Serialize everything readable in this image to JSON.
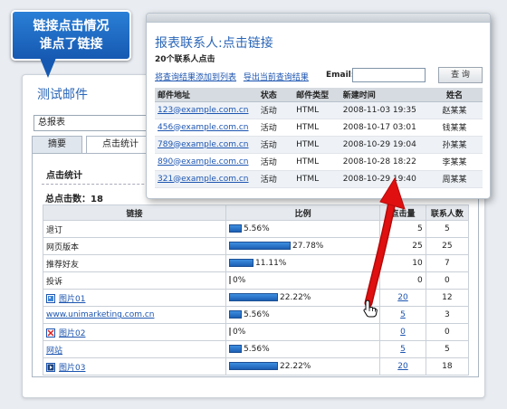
{
  "callout": {
    "line1": "链接点击情况",
    "line2": "谁点了链接"
  },
  "main": {
    "title": "测试邮件",
    "report_select": "总报表",
    "tabs": [
      {
        "label": "摘要"
      },
      {
        "label": "点击统计"
      }
    ],
    "stats_heading": "点击统计",
    "total_clicks": "总点击数：18"
  },
  "stats_table": {
    "headers": {
      "link": "链接",
      "ratio": "比例",
      "clicks": "点击量",
      "contacts": "联系人数"
    },
    "rows": [
      {
        "link": "退订",
        "link_style": "text",
        "icon": "",
        "pct": "5.56%",
        "fraction": 0.0556,
        "clicks": "5",
        "clicks_link": false,
        "contacts": "5"
      },
      {
        "link": "网页版本",
        "link_style": "text",
        "icon": "",
        "pct": "27.78%",
        "fraction": 0.2778,
        "clicks": "25",
        "clicks_link": false,
        "contacts": "25"
      },
      {
        "link": "推荐好友",
        "link_style": "text",
        "icon": "",
        "pct": "11.11%",
        "fraction": 0.1111,
        "clicks": "10",
        "clicks_link": false,
        "contacts": "7"
      },
      {
        "link": "投诉",
        "link_style": "text",
        "icon": "",
        "pct": "0%",
        "fraction": 0,
        "clicks": "0",
        "clicks_link": false,
        "contacts": "0"
      },
      {
        "link": "图片01",
        "link_style": "link",
        "icon": "image-icon",
        "pct": "22.22%",
        "fraction": 0.2222,
        "clicks": "20",
        "clicks_link": true,
        "contacts": "12"
      },
      {
        "link": "www.unimarketing.com.cn",
        "link_style": "link",
        "icon": "",
        "pct": "5.56%",
        "fraction": 0.0556,
        "clicks": "5",
        "clicks_link": true,
        "contacts": "3"
      },
      {
        "link": "图片02",
        "link_style": "link",
        "icon": "broken-image-icon",
        "pct": "0%",
        "fraction": 0,
        "clicks": "0",
        "clicks_link": true,
        "contacts": "0"
      },
      {
        "link": "网站",
        "link_style": "link",
        "icon": "",
        "pct": "5.56%",
        "fraction": 0.0556,
        "clicks": "5",
        "clicks_link": true,
        "contacts": "5"
      },
      {
        "link": "图片03",
        "link_style": "link",
        "icon": "play-image-icon",
        "pct": "22.22%",
        "fraction": 0.2222,
        "clicks": "20",
        "clicks_link": true,
        "contacts": "18"
      }
    ]
  },
  "popup": {
    "title": "报表联系人:点击链接",
    "subtitle": "20个联系人点击",
    "links": [
      "将查询结果添加到列表",
      "导出当前查询结果"
    ],
    "email_label": "Email:",
    "email_value": "",
    "query_button": "查 询",
    "headers": {
      "email": "邮件地址",
      "status": "状态",
      "type": "邮件类型",
      "time": "新建时间",
      "name": "姓名"
    },
    "rows": [
      {
        "email": "123@example.com.cn",
        "status": "活动",
        "type": "HTML",
        "time": "2008-11-03 19:35",
        "name": "赵某某"
      },
      {
        "email": "456@example.com.cn",
        "status": "活动",
        "type": "HTML",
        "time": "2008-10-17 03:01",
        "name": "钱某某"
      },
      {
        "email": "789@example.com.cn",
        "status": "活动",
        "type": "HTML",
        "time": "2008-10-29 19:04",
        "name": "孙某某"
      },
      {
        "email": "890@example.com.cn",
        "status": "活动",
        "type": "HTML",
        "time": "2008-10-28 18:22",
        "name": "李某某"
      },
      {
        "email": "321@example.com.cn",
        "status": "活动",
        "type": "HTML",
        "time": "2008-10-29 19:40",
        "name": "周某某"
      }
    ]
  },
  "colors": {
    "accent": "#2a66b8",
    "callout": "#1659b2",
    "arrow": "#e01010",
    "bar": "#1c5fb3"
  }
}
